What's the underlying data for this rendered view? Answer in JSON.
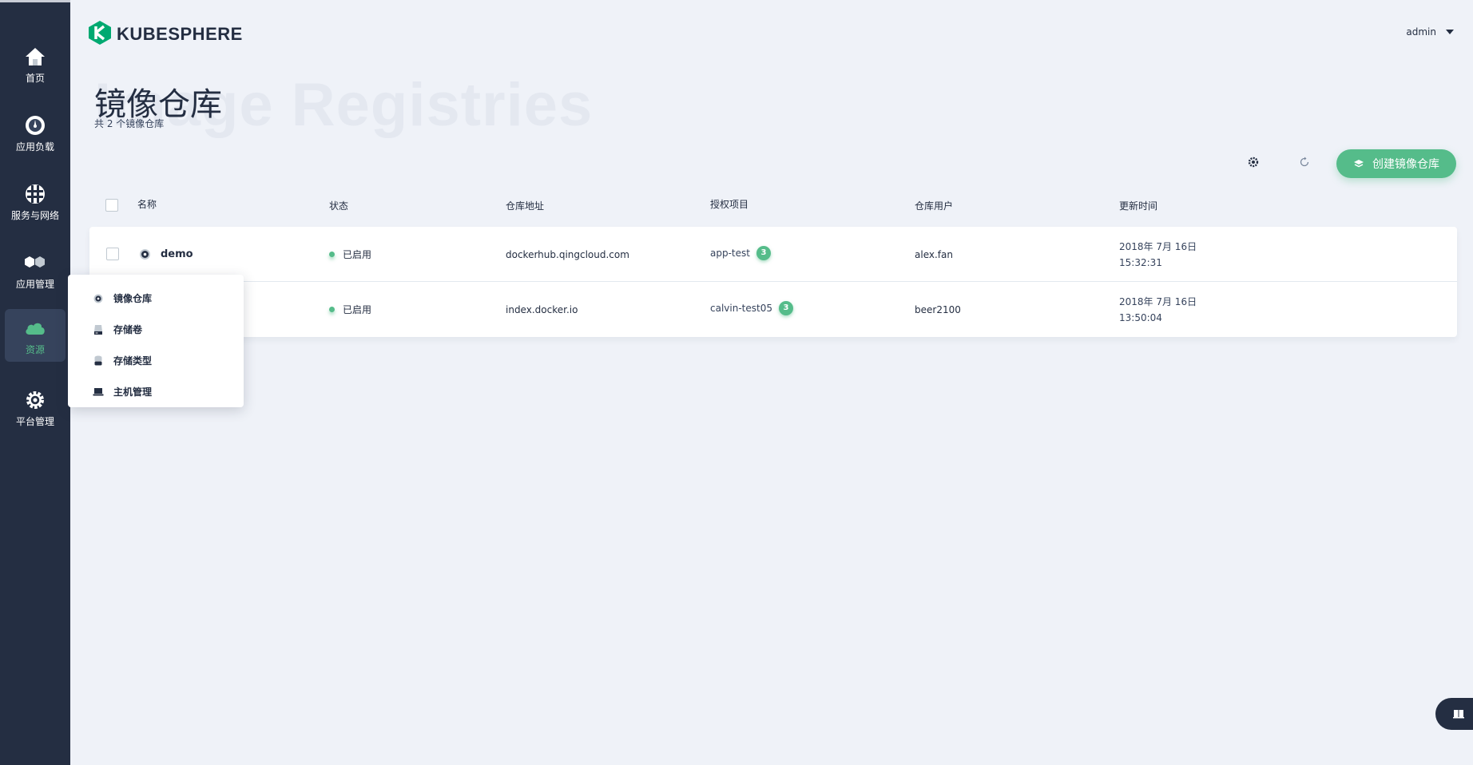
{
  "header": {
    "logo_text": "KUBESPHERE",
    "user": "admin"
  },
  "sidebar": {
    "items": [
      {
        "label": "首页",
        "icon": "home-icon"
      },
      {
        "label": "应用负载",
        "icon": "dashboard-icon"
      },
      {
        "label": "服务与网络",
        "icon": "network-icon"
      },
      {
        "label": "应用管理",
        "icon": "hexagons-icon"
      },
      {
        "label": "资源",
        "icon": "cloud-icon",
        "active": true
      },
      {
        "label": "平台管理",
        "icon": "gear-icon"
      }
    ]
  },
  "page": {
    "bg_title": "Image Registries",
    "title": "镜像仓库",
    "subtitle": "共 2 个镜像仓库"
  },
  "toolbar": {
    "create_label": "创建镜像仓库"
  },
  "table": {
    "columns": [
      "名称",
      "状态",
      "仓库地址",
      "授权项目",
      "仓库用户",
      "更新时间"
    ],
    "rows": [
      {
        "name": "demo",
        "status": "已启用",
        "address": "dockerhub.qingcloud.com",
        "project": "app-test",
        "project_count": "3",
        "user": "alex.fan",
        "date": "2018年 7月 16日",
        "time": "15:32:31"
      },
      {
        "name": "",
        "status": "已启用",
        "address": "index.docker.io",
        "project": "calvin-test05",
        "project_count": "3",
        "user": "beer2100",
        "date": "2018年 7月 16日",
        "time": "13:50:04"
      }
    ]
  },
  "dropdown": {
    "items": [
      {
        "label": "镜像仓库",
        "icon": "registry-icon"
      },
      {
        "label": "存储卷",
        "icon": "volume-icon"
      },
      {
        "label": "存储类型",
        "icon": "database-icon"
      },
      {
        "label": "主机管理",
        "icon": "laptop-icon"
      }
    ]
  },
  "colors": {
    "sidebar": "#242e42",
    "accent": "#55bc8a",
    "background": "#eff2f8"
  }
}
